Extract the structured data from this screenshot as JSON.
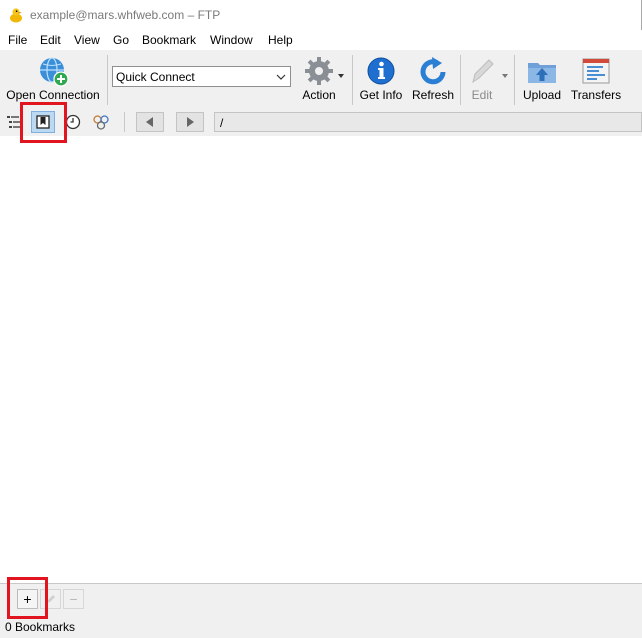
{
  "window": {
    "title": "example@mars.whfweb.com – FTP"
  },
  "menu": [
    "File",
    "Edit",
    "View",
    "Go",
    "Bookmark",
    "Window",
    "Help"
  ],
  "toolbar": {
    "open_connection": "Open Connection",
    "quick_connect": "Quick Connect",
    "action": "Action",
    "get_info": "Get Info",
    "refresh": "Refresh",
    "edit": "Edit",
    "upload": "Upload",
    "transfers": "Transfers"
  },
  "nav": {
    "path": "/"
  },
  "bottom": {
    "add": "+",
    "remove": "−"
  },
  "status": {
    "text": "0 Bookmarks"
  },
  "colors": {
    "highlight": "#e0151f",
    "info_blue": "#1e6fd0",
    "accent_blue": "#2a7fd4"
  }
}
